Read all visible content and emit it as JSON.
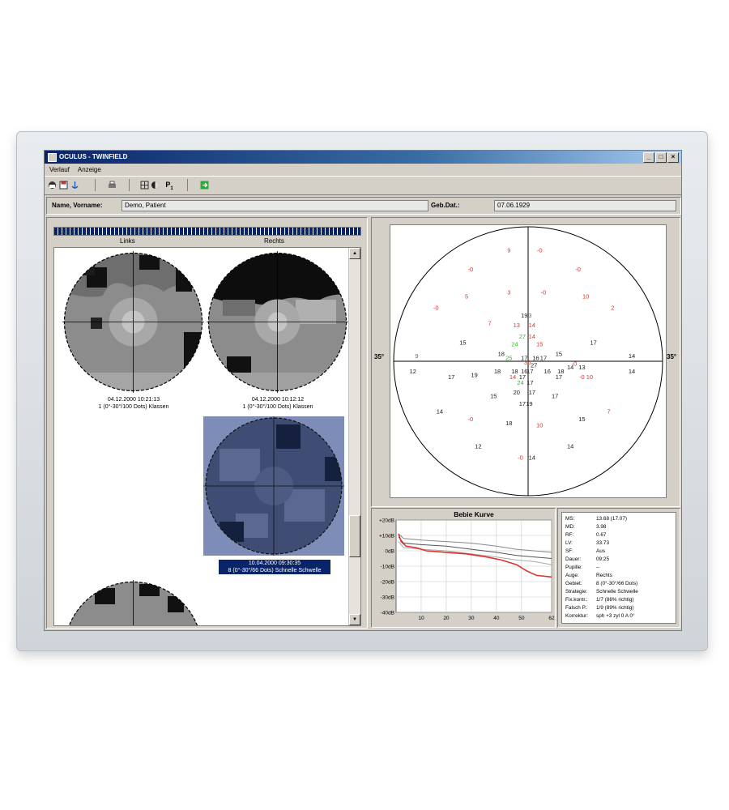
{
  "app": {
    "title": "OCULUS - TWINFIELD",
    "window_buttons": [
      "_",
      "□",
      "×"
    ],
    "menu": [
      "Verlauf",
      "Anzeige"
    ]
  },
  "toolbar": {
    "icons": [
      "open-icon",
      "save-icon",
      "anchor-icon",
      "print-icon",
      "grid-icon",
      "eye-icon",
      "p1-icon",
      "exit-icon"
    ],
    "p_label": "P",
    "p_sub": "1"
  },
  "patient": {
    "name_label": "Name, Vorname:",
    "name_value": "Demo, Patient",
    "dob_label": "Geb.Dat.:",
    "dob_value": "07.06.1929"
  },
  "list": {
    "progress_fraction": 1.0,
    "col_left": "Links",
    "col_right": "Rechts",
    "exams": [
      {
        "eye": "left",
        "date": "04.12.2000 10:21:13",
        "program": "1 (0°-30°/100 Dots) Klassen",
        "selected": false
      },
      {
        "eye": "right",
        "date": "04.12.2000 10:12:12",
        "program": "1 (0°-30°/100 Dots) Klassen",
        "selected": false
      },
      {
        "eye": "right",
        "date": "10.04.2000 09:30:35",
        "program": "8 (0°-30°/66 Dots) Schnelle Schwelle",
        "selected": true
      },
      {
        "eye": "left",
        "date": "",
        "program": "",
        "selected": false
      }
    ]
  },
  "polar": {
    "edge_label_left": "35°",
    "edge_label_right": "35°",
    "colors": {
      "normal": "#1a1a1a",
      "defect": "#e0322d",
      "high": "#2bbf2b"
    },
    "points": [
      {
        "x": -5,
        "y": 29,
        "v": "9",
        "c": "defect"
      },
      {
        "x": 3,
        "y": 29,
        "v": "-0",
        "c": "defect"
      },
      {
        "x": -15,
        "y": 24,
        "v": "-0",
        "c": "defect"
      },
      {
        "x": 13,
        "y": 24,
        "v": "-0",
        "c": "defect"
      },
      {
        "x": -16,
        "y": 17,
        "v": "5",
        "c": "defect"
      },
      {
        "x": -5,
        "y": 18,
        "v": "3",
        "c": "defect"
      },
      {
        "x": 4,
        "y": 18,
        "v": "-0",
        "c": "defect"
      },
      {
        "x": 15,
        "y": 17,
        "v": "10",
        "c": "defect"
      },
      {
        "x": -24,
        "y": 14,
        "v": "-0",
        "c": "defect"
      },
      {
        "x": 22,
        "y": 14,
        "v": "2",
        "c": "defect"
      },
      {
        "x": -1,
        "y": 12,
        "v": "19",
        "c": "normal"
      },
      {
        "x": 0.5,
        "y": 12,
        "v": "3",
        "c": "defect"
      },
      {
        "x": -10,
        "y": 10,
        "v": "7",
        "c": "defect"
      },
      {
        "x": -3,
        "y": 9.5,
        "v": "13",
        "c": "defect"
      },
      {
        "x": 1,
        "y": 9.5,
        "v": "14",
        "c": "defect"
      },
      {
        "x": -1.5,
        "y": 6.5,
        "v": "27",
        "c": "high"
      },
      {
        "x": 1,
        "y": 6.5,
        "v": "14",
        "c": "defect"
      },
      {
        "x": -17,
        "y": 5,
        "v": "15",
        "c": "normal"
      },
      {
        "x": -3.5,
        "y": 4.5,
        "v": "24",
        "c": "high"
      },
      {
        "x": 3,
        "y": 4.5,
        "v": "15",
        "c": "defect"
      },
      {
        "x": 17,
        "y": 5,
        "v": "17",
        "c": "normal"
      },
      {
        "x": -7,
        "y": 2,
        "v": "18",
        "c": "normal"
      },
      {
        "x": -5,
        "y": 1,
        "v": "25",
        "c": "high"
      },
      {
        "x": -1,
        "y": 1,
        "v": "17",
        "c": "normal"
      },
      {
        "x": 2,
        "y": 1,
        "v": "16",
        "c": "normal"
      },
      {
        "x": 4,
        "y": 1,
        "v": "17",
        "c": "normal"
      },
      {
        "x": 8,
        "y": 2,
        "v": "15",
        "c": "normal"
      },
      {
        "x": -29,
        "y": 1.5,
        "v": "9",
        "c": "defect"
      },
      {
        "x": 27,
        "y": 1.5,
        "v": "14",
        "c": "normal"
      },
      {
        "x": -0.2,
        "y": -0.2,
        "v": "30",
        "c": "defect"
      },
      {
        "x": 1.5,
        "y": -1,
        "v": "27",
        "c": "normal"
      },
      {
        "x": 12,
        "y": -0.5,
        "v": "-0",
        "c": "defect"
      },
      {
        "x": 11,
        "y": -1.5,
        "v": "14",
        "c": "normal"
      },
      {
        "x": 14,
        "y": -1.5,
        "v": "13",
        "c": "normal"
      },
      {
        "x": -30,
        "y": -2.5,
        "v": "12",
        "c": "normal"
      },
      {
        "x": -8,
        "y": -2.5,
        "v": "18",
        "c": "normal"
      },
      {
        "x": -3.5,
        "y": -2.5,
        "v": "18",
        "c": "normal"
      },
      {
        "x": -1,
        "y": -2.5,
        "v": "16",
        "c": "normal"
      },
      {
        "x": 0.5,
        "y": -2.5,
        "v": "17",
        "c": "normal"
      },
      {
        "x": 5,
        "y": -2.5,
        "v": "16",
        "c": "normal"
      },
      {
        "x": 8.5,
        "y": -2.5,
        "v": "18",
        "c": "normal"
      },
      {
        "x": 27,
        "y": -2.5,
        "v": "14",
        "c": "normal"
      },
      {
        "x": -20,
        "y": -4,
        "v": "17",
        "c": "normal"
      },
      {
        "x": -14,
        "y": -3.5,
        "v": "19",
        "c": "normal"
      },
      {
        "x": -4,
        "y": -4,
        "v": "14",
        "c": "defect"
      },
      {
        "x": -1.5,
        "y": -4,
        "v": "17",
        "c": "normal"
      },
      {
        "x": 8,
        "y": -4,
        "v": "17",
        "c": "normal"
      },
      {
        "x": 14,
        "y": -4,
        "v": "-0",
        "c": "defect"
      },
      {
        "x": 16,
        "y": -4,
        "v": "10",
        "c": "defect"
      },
      {
        "x": -2,
        "y": -5.5,
        "v": "24",
        "c": "high"
      },
      {
        "x": 0.5,
        "y": -5.5,
        "v": "17",
        "c": "normal"
      },
      {
        "x": -3,
        "y": -8,
        "v": "20",
        "c": "normal"
      },
      {
        "x": 1,
        "y": -8,
        "v": "17",
        "c": "normal"
      },
      {
        "x": -9,
        "y": -9,
        "v": "15",
        "c": "normal"
      },
      {
        "x": 7,
        "y": -9,
        "v": "17",
        "c": "normal"
      },
      {
        "x": -1.5,
        "y": -11,
        "v": "17",
        "c": "normal"
      },
      {
        "x": 0.3,
        "y": -11,
        "v": "19",
        "c": "normal"
      },
      {
        "x": -23,
        "y": -13,
        "v": "14",
        "c": "normal"
      },
      {
        "x": 21,
        "y": -13,
        "v": "7",
        "c": "defect"
      },
      {
        "x": -15,
        "y": -15,
        "v": "-0",
        "c": "defect"
      },
      {
        "x": 14,
        "y": -15,
        "v": "15",
        "c": "normal"
      },
      {
        "x": -5,
        "y": -16,
        "v": "18",
        "c": "normal"
      },
      {
        "x": 3,
        "y": -16.5,
        "v": "10",
        "c": "defect"
      },
      {
        "x": -13,
        "y": -22,
        "v": "12",
        "c": "normal"
      },
      {
        "x": 11,
        "y": -22,
        "v": "14",
        "c": "normal"
      },
      {
        "x": -2,
        "y": -25,
        "v": "-0",
        "c": "defect"
      },
      {
        "x": 1,
        "y": -25,
        "v": "14",
        "c": "normal"
      }
    ]
  },
  "chart_data": {
    "type": "line",
    "title": "Bebie Kurve",
    "xlabel": "",
    "ylabel": "",
    "xlim": [
      0,
      62
    ],
    "ylim": [
      -40,
      20
    ],
    "x_ticks": [
      10,
      20,
      30,
      40,
      50,
      62
    ],
    "y_ticks": [
      20,
      10,
      0,
      -10,
      -20,
      -30,
      -40
    ],
    "y_tick_labels": [
      "+20dB",
      "+10dB",
      "0dB",
      "-10dB",
      "-20dB",
      "-30dB",
      "-40dB"
    ],
    "grid": true,
    "series": [
      {
        "color": "#888888",
        "x": [
          1,
          3,
          10,
          20,
          30,
          40,
          48,
          55,
          62
        ],
        "y": [
          11,
          8,
          7,
          6,
          5,
          3,
          1,
          0,
          -1
        ]
      },
      {
        "color": "#555555",
        "x": [
          1,
          3,
          10,
          20,
          30,
          40,
          48,
          55,
          62
        ],
        "y": [
          9,
          5,
          4,
          3,
          1,
          -1,
          -3,
          -4,
          -5
        ]
      },
      {
        "color": "#aaaaaa",
        "x": [
          1,
          3,
          10,
          20,
          30,
          40,
          48,
          55,
          62
        ],
        "y": [
          6,
          2,
          1,
          0,
          -2,
          -4,
          -6,
          -7,
          -9
        ]
      },
      {
        "color": "#e0322d",
        "x": [
          1,
          2,
          4,
          8,
          12,
          20,
          28,
          36,
          42,
          48,
          52,
          56,
          62
        ],
        "y": [
          11,
          6,
          3,
          2,
          0,
          -1,
          -2,
          -4,
          -6,
          -9,
          -13,
          -16,
          -17
        ]
      }
    ]
  },
  "stats": {
    "rows": [
      {
        "k": "MS:",
        "v": "13.68 (17.07)"
      },
      {
        "k": "MD:",
        "v": "3.98"
      },
      {
        "k": "RF:",
        "v": "0.67"
      },
      {
        "k": "LV:",
        "v": "33.73"
      },
      {
        "k": "SF:",
        "v": "Aus"
      },
      {
        "k": "Dauer:",
        "v": "09:25"
      },
      {
        "k": "Pupille:",
        "v": "--"
      },
      {
        "k": "Auge:",
        "v": "Rechts"
      },
      {
        "k": "Gebiet:",
        "v": "8 (0°-30°/66 Dots)"
      },
      {
        "k": "Strategie:",
        "v": "Schnelle Schwelle"
      },
      {
        "k": "Fix.kontr.:",
        "v": "1/7 (86% richtig)"
      },
      {
        "k": "Falsch P.:",
        "v": "1/9 (89% richtig)"
      },
      {
        "k": "Korrektur:",
        "v": "sph +3 zyl 0 A 0°"
      }
    ]
  }
}
